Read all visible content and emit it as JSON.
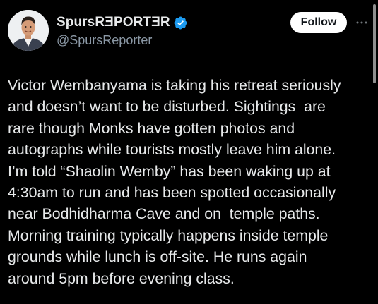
{
  "post": {
    "author": {
      "display_name": "SpursRƎPORTƎR",
      "handle": "@SpursReporter",
      "verified_icon": "verified-badge-icon",
      "avatar_icon": "profile-photo-avatar"
    },
    "follow_label": "Follow",
    "more_icon": "more-horizontal-icon",
    "text": "Victor Wembanyama is taking his retreat seriously\nand doesn’t want to be disturbed. Sightings  are\nrare though Monks have gotten photos and\nautographs while tourists mostly leave him alone.\nI’m told “Shaolin Wemby” has been waking up at\n4:30am to run and has been spotted occasionally\nnear Bodhidharma Cave and on  temple paths.\nMorning training typically happens inside temple\ngrounds while lunch is off-site. He runs again\naround 5pm before evening class."
  },
  "colors": {
    "background": "#000000",
    "text_primary": "#e7e9ea",
    "text_secondary": "#8b98a5",
    "verified_blue": "#1d9bf0",
    "follow_bg": "#ffffff",
    "follow_text": "#0f1419"
  }
}
